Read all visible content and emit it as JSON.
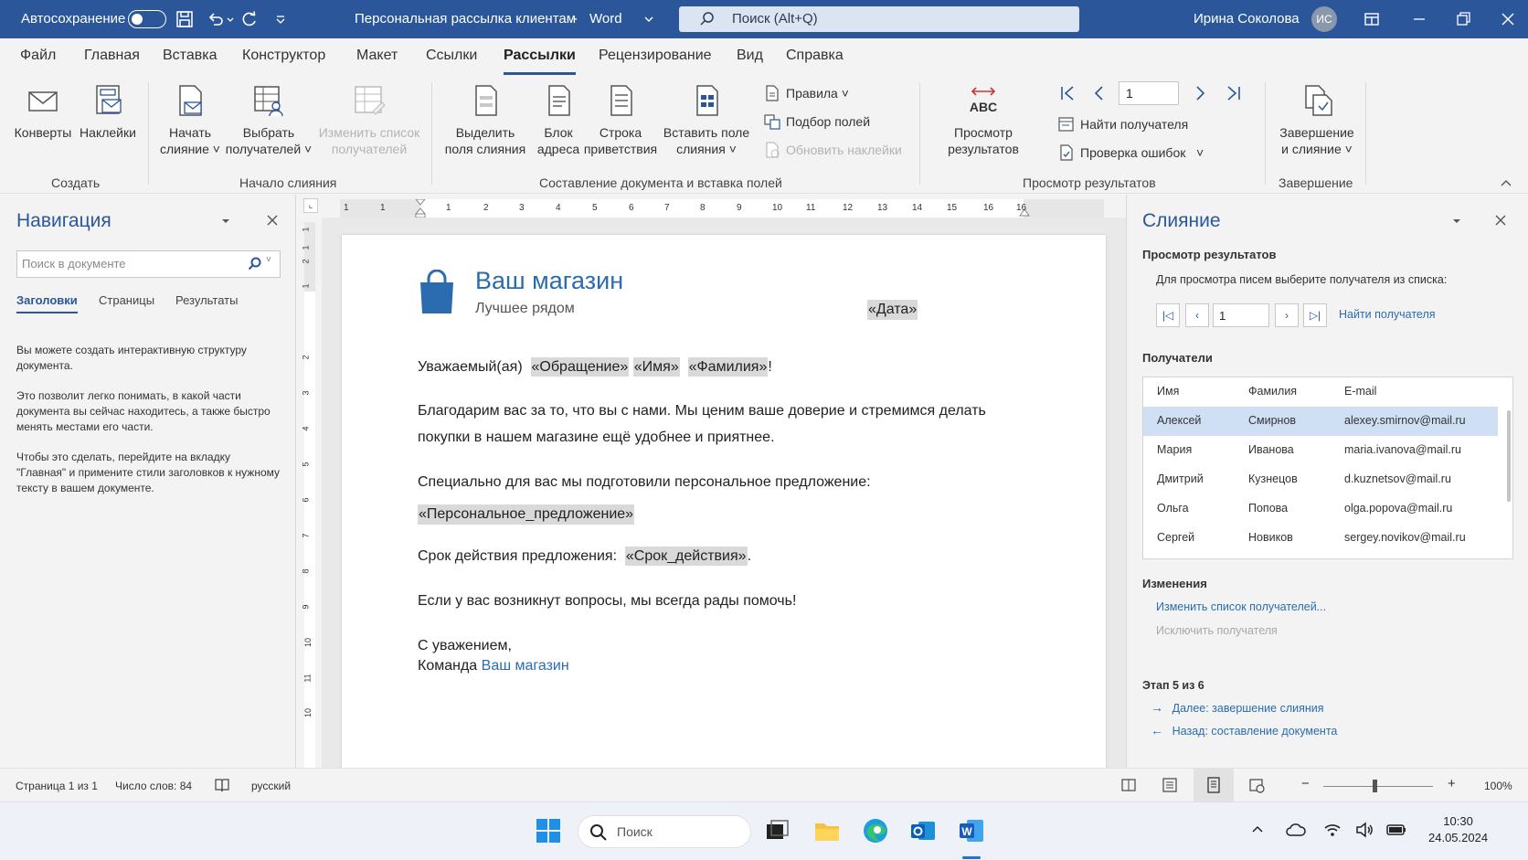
{
  "titlebar": {
    "autosave_label": "Автосохранение",
    "doc_title": "Персональная рассылка клиентам",
    "separator": "-",
    "app_name": "Word",
    "search_placeholder": "Поиск (Alt+Q)",
    "user_name": "Ирина Соколова",
    "user_initials": "ИС"
  },
  "menu": {
    "tabs": [
      "Файл",
      "Главная",
      "Вставка",
      "Конструктор",
      "Макет",
      "Ссылки",
      "Рассылки",
      "Рецензирование",
      "Вид",
      "Справка"
    ],
    "active": "Рассылки"
  },
  "ribbon": {
    "create": {
      "envelopes": "Конверты",
      "labels": "Наклейки",
      "group": "Создать"
    },
    "start": {
      "start_merge_1": "Начать",
      "start_merge_2": "слияние",
      "select_recipients_1": "Выбрать",
      "select_recipients_2": "получателей",
      "edit_list_1": "Изменить список",
      "edit_list_2": "получателей",
      "group": "Начало слияния"
    },
    "write": {
      "highlight_1": "Выделить",
      "highlight_2": "поля слияния",
      "address_1": "Блок",
      "address_2": "адреса",
      "greeting_1": "Строка",
      "greeting_2": "приветствия",
      "insert_field_1": "Вставить поле",
      "insert_field_2": "слияния",
      "rules": "Правила",
      "match_fields": "Подбор полей",
      "update_labels": "Обновить наклейки",
      "group": "Составление документа и вставка полей"
    },
    "preview": {
      "preview_1": "Просмотр",
      "preview_2": "результатов",
      "record": "1",
      "find_recipient": "Найти получателя",
      "check_errors": "Проверка ошибок",
      "group": "Просмотр результатов"
    },
    "finish": {
      "finish_1": "Завершение",
      "finish_2": "и слияние",
      "group": "Завершение"
    }
  },
  "nav": {
    "title": "Навигация",
    "search_placeholder": "Поиск в документе",
    "tabs": [
      "Заголовки",
      "Страницы",
      "Результаты"
    ],
    "p1": "Вы можете создать интерактивную структуру документа.",
    "p2": "Это позволит легко понимать, в какой части документа вы сейчас находитесь, а также быстро менять местами его части.",
    "p3": "Чтобы это сделать, перейдите на вкладку \"Главная\" и примените стили заголовков к нужному тексту в вашем документе."
  },
  "ruler": {
    "h": [
      "1",
      "1",
      "1",
      "2",
      "3",
      "4",
      "5",
      "6",
      "7",
      "8",
      "9",
      "10",
      "11",
      "12",
      "13",
      "14",
      "15",
      "16",
      "16"
    ],
    "v": [
      "1",
      "1",
      "2",
      "1",
      "2",
      "3",
      "4",
      "5",
      "6",
      "7",
      "8",
      "9",
      "10",
      "11",
      "10"
    ]
  },
  "doc": {
    "brand": "Ваш магазин",
    "slogan": "Лучшее рядом",
    "date_field": "«Дата»",
    "greet_prefix": "Уважаемый(ая)",
    "f_salutation": "«Обращение»",
    "f_name": "«Имя»",
    "f_surname": "«Фамилия»",
    "exclaim": "!",
    "p1_l1": "Благодарим вас за то, что вы с нами. Мы ценим ваше доверие и стремимся делать",
    "p1_l2": "покупки в нашем магазине ещё удобнее и приятнее.",
    "p2": "Специально для вас мы подготовили персональное предложение:",
    "f_offer": "«Персональное_предложение»",
    "validity_prefix": "Срок действия предложения:",
    "f_validity": "«Срок_действия»",
    "period": ".",
    "p4": "Если у вас возникнут вопросы, мы всегда рады помочь!",
    "regards": "С уважением,",
    "team": "Команда",
    "team_brand": "Ваш магазин"
  },
  "merge": {
    "title": "Слияние",
    "preview_heading": "Просмотр результатов",
    "preview_text": "Для просмотра писем выберите получателя из списка:",
    "record": "1",
    "find": "Найти получателя",
    "recipients_heading": "Получатели",
    "columns": [
      "Имя",
      "Фамилия",
      "E-mail"
    ],
    "rows": [
      [
        "Алексей",
        "Смирнов",
        "alexey.smirnov@mail.ru"
      ],
      [
        "Мария",
        "Иванова",
        "maria.ivanova@mail.ru"
      ],
      [
        "Дмитрий",
        "Кузнецов",
        "d.kuznetsov@mail.ru"
      ],
      [
        "Ольга",
        "Попова",
        "olga.popova@mail.ru"
      ],
      [
        "Сергей",
        "Новиков",
        "sergey.novikov@mail.ru"
      ]
    ],
    "changes_heading": "Изменения",
    "edit_list": "Изменить список получателей...",
    "exclude": "Исключить получателя",
    "step": "Этап 5 из 6",
    "next": "Далее: завершение слияния",
    "back": "Назад: составление документа"
  },
  "status": {
    "page": "Страница 1 из 1",
    "words": "Число слов: 84",
    "language": "русский",
    "zoom": "100%",
    "zoom_minus": "−",
    "zoom_plus": "+"
  },
  "taskbar": {
    "search": "Поиск",
    "time": "10:30",
    "date": "24.05.2024"
  },
  "colors": {
    "word_blue": "#2b579a",
    "link_blue": "#2b6cb0",
    "field_grey": "#d9d9d9",
    "selected_row": "#cfe0f5"
  }
}
